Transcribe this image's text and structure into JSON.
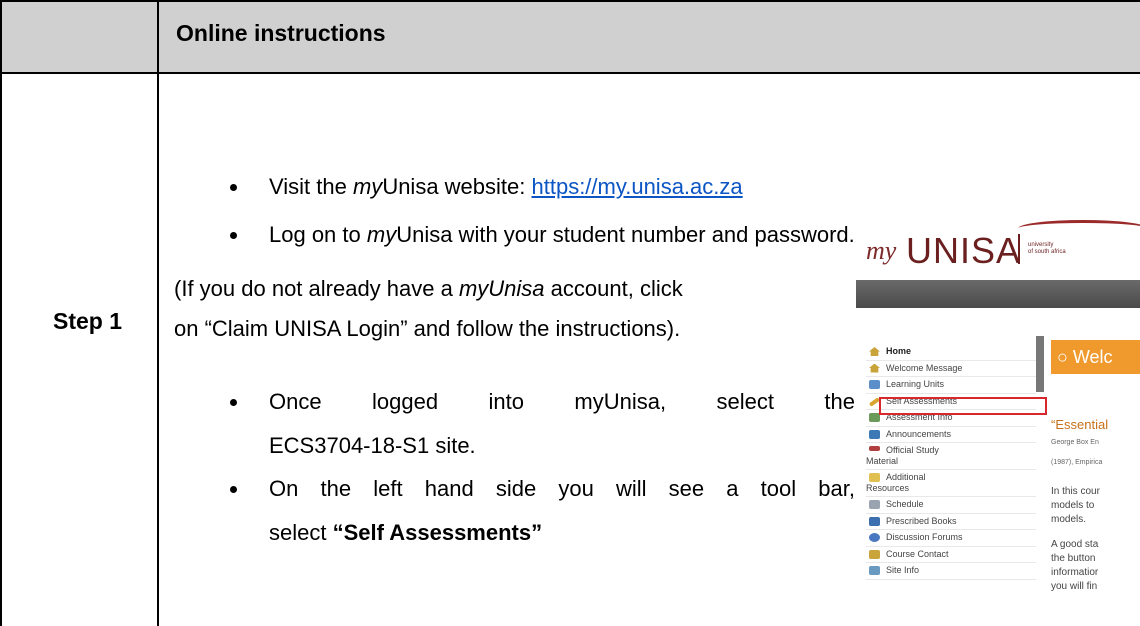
{
  "header": {
    "title": "Online instructions"
  },
  "step_label": "Step 1",
  "bullets_top": [
    {
      "prefix": "Visit the ",
      "italic": "my",
      "suffix": "Unisa website: ",
      "link": "https://my.unisa.ac.za"
    },
    {
      "prefix": "Log on to ",
      "italic": "my",
      "suffix": "Unisa with your student number and password."
    }
  ],
  "note": {
    "line1_prefix": "(If you do not already have a ",
    "line1_italic": "myUnisa",
    "line1_suffix": " account, click",
    "line2": "on “Claim UNISA Login” and follow the instructions)."
  },
  "bullets_bottom": [
    {
      "line1": "Once logged into myUnisa, select the",
      "line2": "ECS3704-18-S1 site."
    },
    {
      "line1": "On the left hand side you will see a tool bar,",
      "line2_prefix": "select ",
      "line2_bold": "“Self Assessments”"
    }
  ],
  "screenshot": {
    "logo_my": "my",
    "logo_name": "UNISA",
    "logo_small_1": "university",
    "logo_small_2": "of south africa",
    "menu": [
      {
        "label": "Home",
        "icon": "home-icon",
        "color": "#c9a43a"
      },
      {
        "label": "Welcome Message",
        "icon": "home-icon",
        "color": "#c9a43a"
      },
      {
        "label": "Learning Units",
        "icon": "window-icon",
        "color": "#5b8fc9"
      },
      {
        "label": "Self Assessments",
        "icon": "pencil-icon",
        "color": "#d8a530"
      },
      {
        "label": "Assessment Info",
        "icon": "info-icon",
        "color": "#6b9a5a"
      },
      {
        "label": "Announcements",
        "icon": "megaphone-icon",
        "color": "#3c79b5"
      },
      {
        "label": "Official Study",
        "label2": "Material",
        "icon": "book-icon",
        "color": "#b04040"
      },
      {
        "label": "Additional",
        "label2": "Resources",
        "icon": "folder-icon",
        "color": "#e0c050"
      },
      {
        "label": "Schedule",
        "icon": "calendar-icon",
        "color": "#9aa3b0"
      },
      {
        "label": "Prescribed Books",
        "icon": "books-icon",
        "color": "#3c6fb0"
      },
      {
        "label": "Discussion Forums",
        "icon": "forum-icon",
        "color": "#4a78c0"
      },
      {
        "label": "Course Contact",
        "icon": "contact-icon",
        "color": "#c9a43a"
      },
      {
        "label": "Site Info",
        "icon": "site-info-icon",
        "color": "#6a9ac0"
      }
    ],
    "welcome": "Welc",
    "quote": "“Essential",
    "author1": "George Box En",
    "author2": "(1987), Empirica",
    "para1": [
      "In this cour",
      "models to",
      "models."
    ],
    "para2": [
      "A good sta",
      "the button",
      "informatior",
      "you will fin"
    ]
  },
  "colors": {
    "link": "#0b55c4",
    "header_bg": "#d0d0d0",
    "highlight": "#d9272e",
    "welcome_bg": "#f09a2e"
  }
}
